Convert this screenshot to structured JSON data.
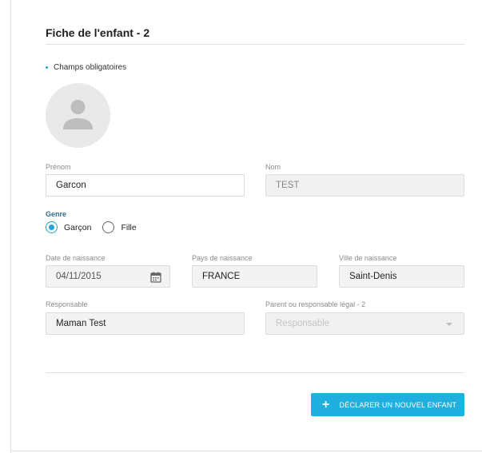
{
  "form": {
    "title": "Fiche de l'enfant - 2",
    "required_note": "Champs obligatoires"
  },
  "fields": {
    "prenom": {
      "label": "Prénom",
      "value": "Garcon"
    },
    "nom": {
      "label": "Nom",
      "value": "TEST"
    },
    "genre": {
      "label": "Genre",
      "options": [
        "Garçon",
        "Fille"
      ],
      "selected": "Garçon"
    },
    "date_naissance": {
      "label": "Date de naissance",
      "value": "04/11/2015"
    },
    "pays_naissance": {
      "label": "Pays de naissance",
      "value": "FRANCE"
    },
    "ville_naissance": {
      "label": "Ville de naissance",
      "value": "Saint-Denis"
    },
    "responsable": {
      "label": "Responsable",
      "value": "Maman Test"
    },
    "parent2": {
      "label": "Parent ou responsable légal - 2",
      "placeholder": "Responsable"
    }
  },
  "actions": {
    "add_child_label": "DÉCLARER UN NOUVEL ENFANT"
  },
  "colors": {
    "accent": "#1fb0e0",
    "genre_label": "#2f6d86"
  },
  "icons": {
    "avatar": "person-icon",
    "calendar": "calendar-icon",
    "dropdown": "chevron-down-icon",
    "add": "plus-icon"
  }
}
